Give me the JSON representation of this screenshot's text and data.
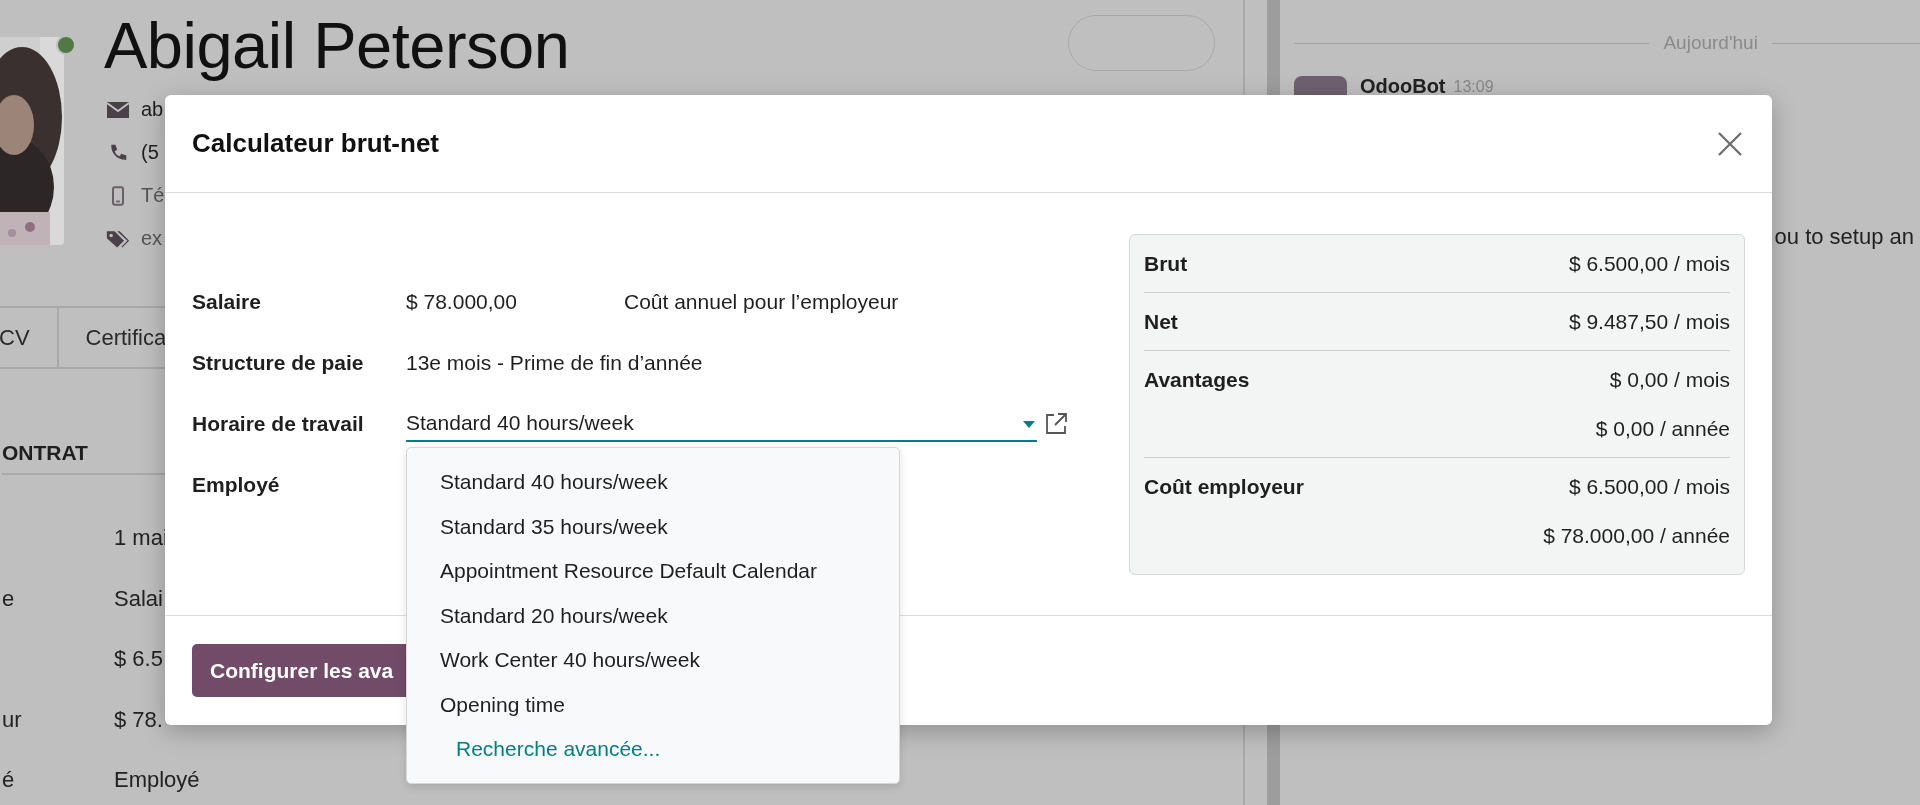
{
  "background": {
    "employee_name": "Abigail Peterson",
    "online": true,
    "contact_lines": [
      {
        "kind": "email",
        "text": "ab",
        "muted": false
      },
      {
        "kind": "phone",
        "text": "(5",
        "muted": false
      },
      {
        "kind": "mobile",
        "text": "Té",
        "muted": true
      },
      {
        "kind": "tags",
        "text": "ex",
        "muted": true
      }
    ],
    "tabs": [
      "CV",
      "Certifica"
    ],
    "section_title": "ONTRAT",
    "rows": [
      {
        "value": "1 mai"
      },
      {
        "label": "e",
        "value": "Salai"
      },
      {
        "value": "$ 6.5"
      },
      {
        "label": "ur",
        "value": "$ 78."
      },
      {
        "label": "é",
        "value": "Employé"
      }
    ],
    "chatter": {
      "date_separator": "Aujourd'hui",
      "author": "OdooBot",
      "time": "13:09",
      "message_fragment": "ou to setup an"
    }
  },
  "dialog": {
    "title": "Calculateur brut-net",
    "fields": [
      {
        "kind": "text",
        "label": "Salaire",
        "value": "$ 78.000,00",
        "note": "Coût annuel pour l’employeur"
      },
      {
        "kind": "text",
        "label": "Structure de paie",
        "value": "13e mois - Prime de fin d’année"
      },
      {
        "kind": "select",
        "label": "Horaire de travail",
        "value": "Standard 40 hours/week"
      },
      {
        "kind": "empty",
        "label": "Employé"
      }
    ],
    "dropdown": {
      "options": [
        "Standard 40 hours/week",
        "Standard 35 hours/week",
        "Appointment Resource Default Calendar",
        "Standard 20 hours/week",
        "Work Center 40 hours/week",
        "Opening time"
      ],
      "advanced_search": "Recherche avancée..."
    },
    "summary": [
      {
        "label": "Brut",
        "values": [
          "$ 6.500,00 / mois"
        ]
      },
      {
        "label": "Net",
        "values": [
          "$ 9.487,50 / mois"
        ]
      },
      {
        "label": "Avantages",
        "values": [
          "$ 0,00 / mois",
          "$ 0,00 / année"
        ]
      },
      {
        "label": "Coût employeur",
        "values": [
          "$ 6.500,00 / mois",
          "$ 78.000,00 / année"
        ]
      }
    ],
    "footer_button": "Configurer les ava"
  }
}
